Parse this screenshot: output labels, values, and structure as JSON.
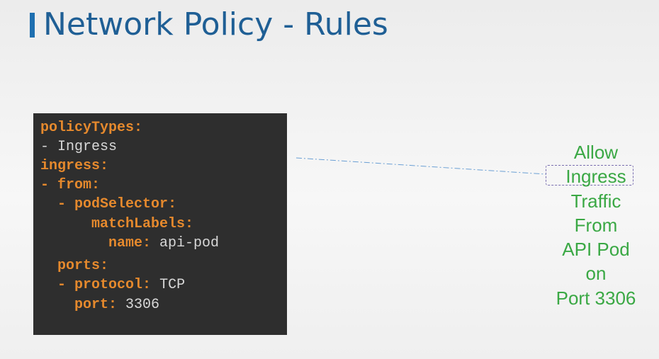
{
  "title": "Network Policy - Rules",
  "code": {
    "lines": [
      {
        "indent": "",
        "dash": "",
        "key": "policyTypes",
        "colon": ":",
        "value": ""
      },
      {
        "indent": "",
        "dash": "- ",
        "key": "",
        "colon": "",
        "value": "Ingress"
      },
      {
        "indent": "",
        "dash": "",
        "key": "ingress",
        "colon": ":",
        "value": ""
      },
      {
        "indent": "",
        "dash": "- ",
        "key": "from",
        "colon": ":",
        "value": ""
      },
      {
        "indent": "  ",
        "dash": "- ",
        "key": "podSelector",
        "colon": ":",
        "value": ""
      },
      {
        "indent": "      ",
        "dash": "",
        "key": "matchLabels",
        "colon": ":",
        "value": ""
      },
      {
        "indent": "        ",
        "dash": "",
        "key": "name",
        "colon": ":",
        "value": " api-pod"
      },
      {
        "indent": "  ",
        "dash": "",
        "key": "ports",
        "colon": ":",
        "value": ""
      },
      {
        "indent": "  ",
        "dash": "- ",
        "key": "protocol",
        "colon": ":",
        "value": " TCP"
      },
      {
        "indent": "    ",
        "dash": "",
        "key": "port",
        "colon": ":",
        "value": " 3306"
      }
    ]
  },
  "callout": {
    "lines": [
      "Allow",
      "Ingress",
      "Traffic",
      "From",
      "API Pod",
      "on",
      "Port 3306"
    ]
  },
  "colors": {
    "title": "#1f5f95",
    "accent": "#1e6fb0",
    "code_bg": "#2e2e2e",
    "code_key": "#e5892d",
    "code_value": "#d8d8d8",
    "callout_text": "#3aa844",
    "connector": "#6a9fd4"
  }
}
